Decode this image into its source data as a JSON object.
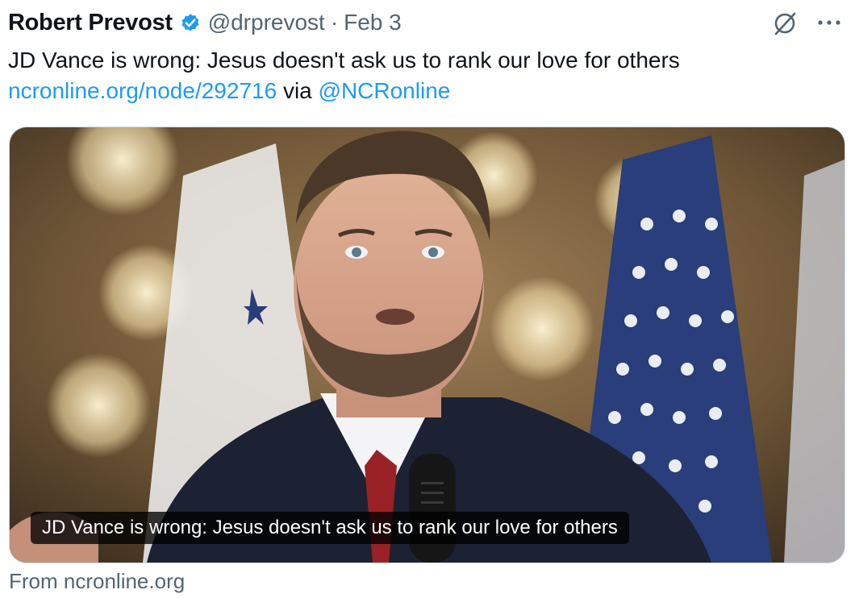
{
  "tweet": {
    "author_name": "Robert Prevost",
    "handle": "@drprevost",
    "separator": "·",
    "date": "Feb 3",
    "text_line1": "JD Vance is wrong: Jesus doesn't ask us to rank our love for others",
    "link_url": "ncronline.org/node/292716",
    "via_label": "via",
    "via_handle": "@NCRonline"
  },
  "card": {
    "caption": "JD Vance is wrong: Jesus doesn't ask us to rank our love for others",
    "source_label": "From ncronline.org"
  },
  "icons": {
    "verified": "verified-badge-icon",
    "grok": "grok-icon",
    "more": "more-icon"
  },
  "colors": {
    "link": "#1d9bf0",
    "verified": "#1d9bf0",
    "secondary_text": "#536471",
    "primary_text": "#0f1419"
  }
}
